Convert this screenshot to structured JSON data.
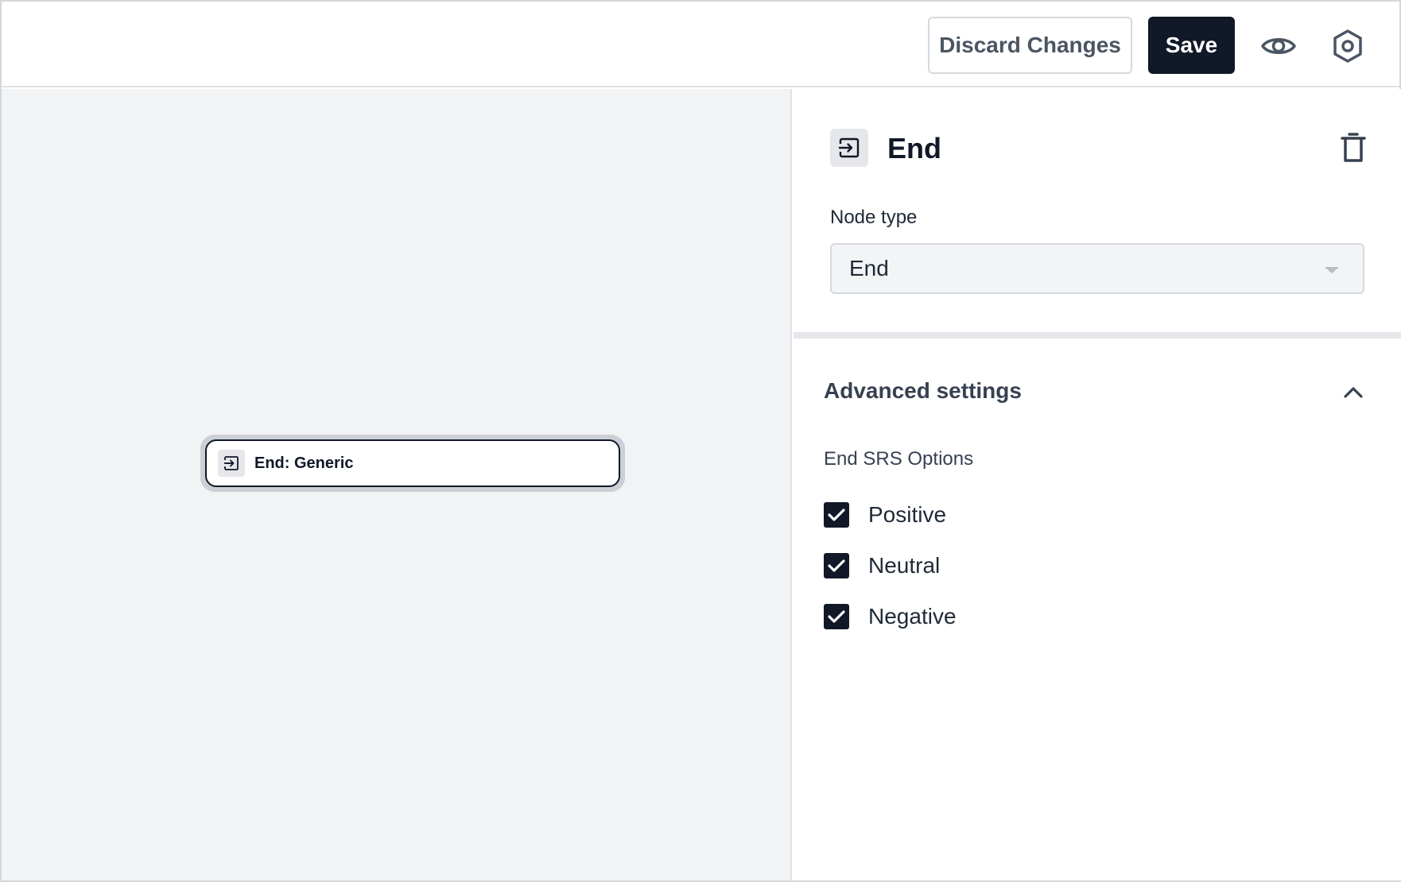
{
  "toolbar": {
    "discard_label": "Discard Changes",
    "save_label": "Save",
    "preview_icon": "eye-icon",
    "settings_icon": "gear-icon"
  },
  "canvas": {
    "node": {
      "icon": "exit-icon",
      "label": "End: Generic"
    }
  },
  "panel": {
    "icon": "exit-icon",
    "title": "End",
    "delete_icon": "trash-icon",
    "node_type_label": "Node type",
    "node_type_value": "End",
    "advanced": {
      "title": "Advanced settings",
      "expanded": true,
      "options_label": "End SRS Options",
      "options": [
        {
          "label": "Positive",
          "checked": true
        },
        {
          "label": "Neutral",
          "checked": true
        },
        {
          "label": "Negative",
          "checked": true
        }
      ]
    }
  },
  "colors": {
    "primary": "#111827",
    "canvas_bg": "#f2f3f5",
    "border": "#d6d9de"
  }
}
